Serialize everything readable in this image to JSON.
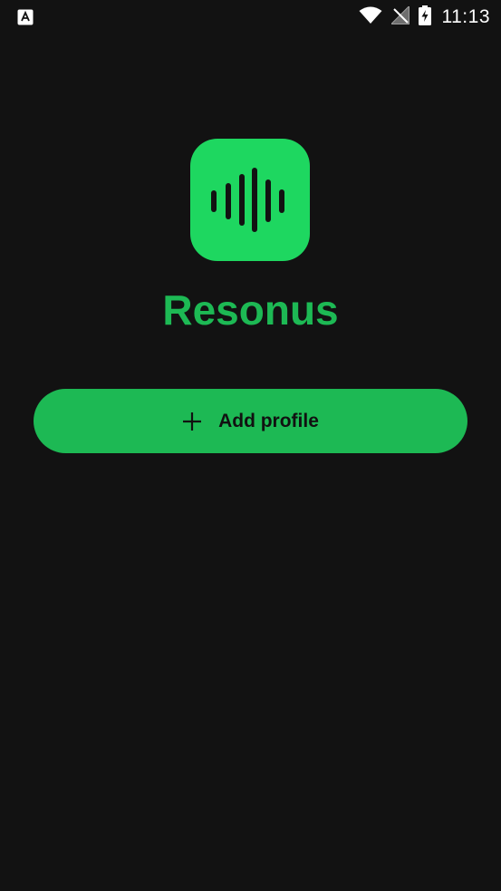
{
  "status_bar": {
    "time": "11:13",
    "icons": [
      "notification-app-icon",
      "wifi-icon",
      "no-signal-icon",
      "battery-charging-icon"
    ]
  },
  "app": {
    "name": "Resonus",
    "logo_icon": "sound-wave-icon"
  },
  "actions": {
    "add_profile_label": "Add profile",
    "add_icon": "plus-icon"
  },
  "colors": {
    "background": "#121212",
    "accent": "#1db954",
    "logo_background": "#1ed760",
    "button_text": "#111111"
  }
}
